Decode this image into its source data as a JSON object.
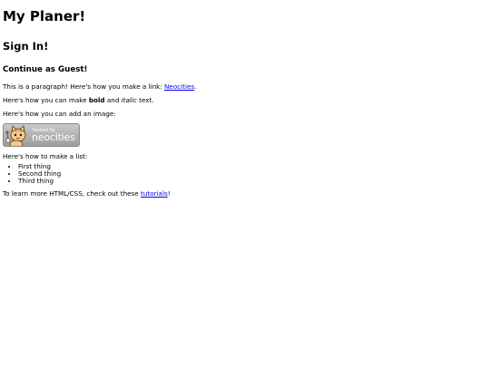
{
  "page": {
    "title": "My Planer!",
    "sign_in": "Sign In!",
    "guest": "Continue as Guest!"
  },
  "para1": {
    "before": "This is a paragraph! Here's how you make a link: ",
    "link": "Neocities",
    "after": "."
  },
  "para2": {
    "before": "Here's how you can make ",
    "bold": "bold",
    "middle": " and ",
    "italic": "italic",
    "after": " text."
  },
  "para3": {
    "text": "Here's how you can add an image:"
  },
  "badge": {
    "small_text": "hosted by",
    "big_text": "neocities",
    "icon": "neocities-cat-icon"
  },
  "para4": {
    "text": "Here's how to make a list:"
  },
  "list": {
    "items": [
      "First thing",
      "Second thing",
      "Third thing"
    ]
  },
  "para5": {
    "before": "To learn more HTML/CSS, check out these ",
    "link": "tutorials",
    "after": "!"
  },
  "colors": {
    "link": "#0000ee",
    "badge_bg": "#b5b5b5"
  }
}
